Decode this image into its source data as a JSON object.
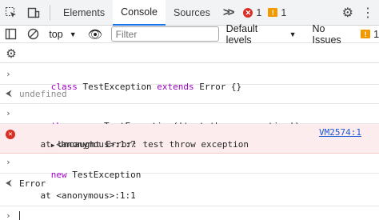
{
  "tabs": [
    "Elements",
    "Console",
    "Sources"
  ],
  "active_tab": "Console",
  "more_tabs": ">>",
  "error_count": "1",
  "warning_count": "1",
  "toolbar": {
    "context": "top",
    "filter_placeholder": "Filter",
    "levels": "Default levels",
    "issues_label": "No Issues",
    "issues_count": "1"
  },
  "console": {
    "entry1": "class TestException extends Error {}",
    "entry1_kw": "class",
    "entry1_name": " TestException ",
    "entry1_kw2": "extends",
    "entry1_rest": " Error {}",
    "result1": "undefined",
    "entry2_kw": "throw new",
    "entry2_rest": " TestException('test throw exception')",
    "error_line1": "Uncaught Error: test throw exception",
    "error_line2": "    at <anonymous>:1:7",
    "error_link": "VM2574:1",
    "entry3_kw": "new",
    "entry3_rest": " TestException",
    "result3_line1": "Error",
    "result3_line2": "    at <anonymous>:1:1"
  },
  "colors": {
    "keyword": "#a100c8",
    "error_bg": "#fdeced",
    "accent": "#1a73e8"
  }
}
